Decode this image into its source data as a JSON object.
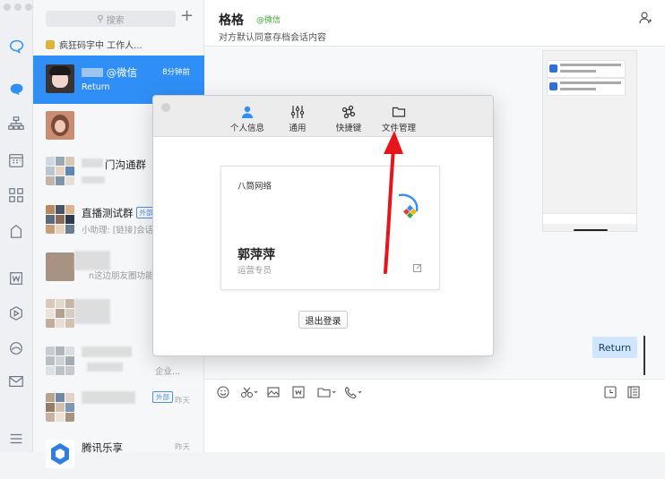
{
  "search": {
    "placeholder": "搜索"
  },
  "notice": {
    "text": "疯狂码字中 工作人..."
  },
  "chats": [
    {
      "name": "@微信",
      "preview": "Return",
      "time": "8分钟前"
    },
    {
      "name": "",
      "preview": "",
      "time": ""
    },
    {
      "name": "门沟通群",
      "preview": "",
      "time": ""
    },
    {
      "name": "直播测试群",
      "tag": "外部",
      "preview": "小助理: [链接]会话存",
      "time": ""
    },
    {
      "name": "",
      "preview": "n这边朋友圈功能这",
      "time": ""
    },
    {
      "name": "",
      "preview": "",
      "time": ""
    },
    {
      "name": "",
      "preview": "企业...",
      "time": ""
    },
    {
      "name": "",
      "tag": "外部",
      "preview": "",
      "time": "昨天"
    },
    {
      "name": "腾讯乐享",
      "preview": "",
      "time": "昨天"
    }
  ],
  "chat": {
    "title": "格格",
    "source": "@微信",
    "subtitle": "对方默认同意存档会话内容",
    "return_label": "Return"
  },
  "modal": {
    "tabs": [
      {
        "label": "个人信息",
        "icon": "person-icon"
      },
      {
        "label": "通用",
        "icon": "sliders-icon"
      },
      {
        "label": "快捷键",
        "icon": "command-icon"
      },
      {
        "label": "文件管理",
        "icon": "folder-icon"
      }
    ],
    "card": {
      "company": "八筒网络",
      "name": "郭萍萍",
      "role": "运营专员"
    },
    "logout_label": "退出登录"
  },
  "colors": {
    "accent": "#2f8ff7",
    "arrow": "#e8141c",
    "wechat_green": "#3aa635"
  }
}
